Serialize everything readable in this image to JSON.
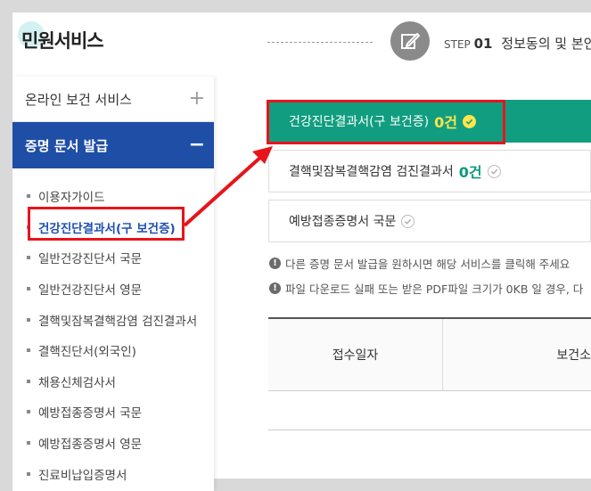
{
  "page": {
    "title": "민원서비스"
  },
  "step": {
    "prefix": "STEP",
    "number": "01",
    "title": "정보동의 및 본인"
  },
  "sidebar": {
    "groups": [
      {
        "label": "온라인 보건 서비스",
        "toggle": "+"
      },
      {
        "label": "증명 문서 발급",
        "toggle": "−"
      }
    ],
    "items": [
      {
        "label": "이용자가이드"
      },
      {
        "label": "건강진단결과서(구 보건증)"
      },
      {
        "label": "일반건강진단서 국문"
      },
      {
        "label": "일반건강진단서 영문"
      },
      {
        "label": "결핵및잠복결핵감염 검진결과서"
      },
      {
        "label": "결핵진단서(외국인)"
      },
      {
        "label": "채용신체검사서"
      },
      {
        "label": "예방접종증명서 국문"
      },
      {
        "label": "예방접종증명서 영문"
      },
      {
        "label": "진료비납입증명서"
      }
    ]
  },
  "cards": [
    {
      "label": "건강진단결과서(구 보건증)",
      "count": "0건"
    },
    {
      "label": "결핵및잠복결핵감염 검진결과서",
      "count": "0건"
    },
    {
      "label": "예방접종증명서 국문",
      "count": ""
    }
  ],
  "notices": [
    "다른 증명 문서 발급을 원하시면 해당 서비스를 클릭해 주세요",
    "파일 다운로드 실패 또는 받은 PDF파일 크기가 0KB 일 경우, 다"
  ],
  "table": {
    "headers": [
      "접수일자",
      "보건소"
    ]
  },
  "colors": {
    "accent_blue": "#1e4ea6",
    "accent_green": "#119e80",
    "highlight_red": "#e8141b",
    "count_yellow": "#ffe54a"
  }
}
